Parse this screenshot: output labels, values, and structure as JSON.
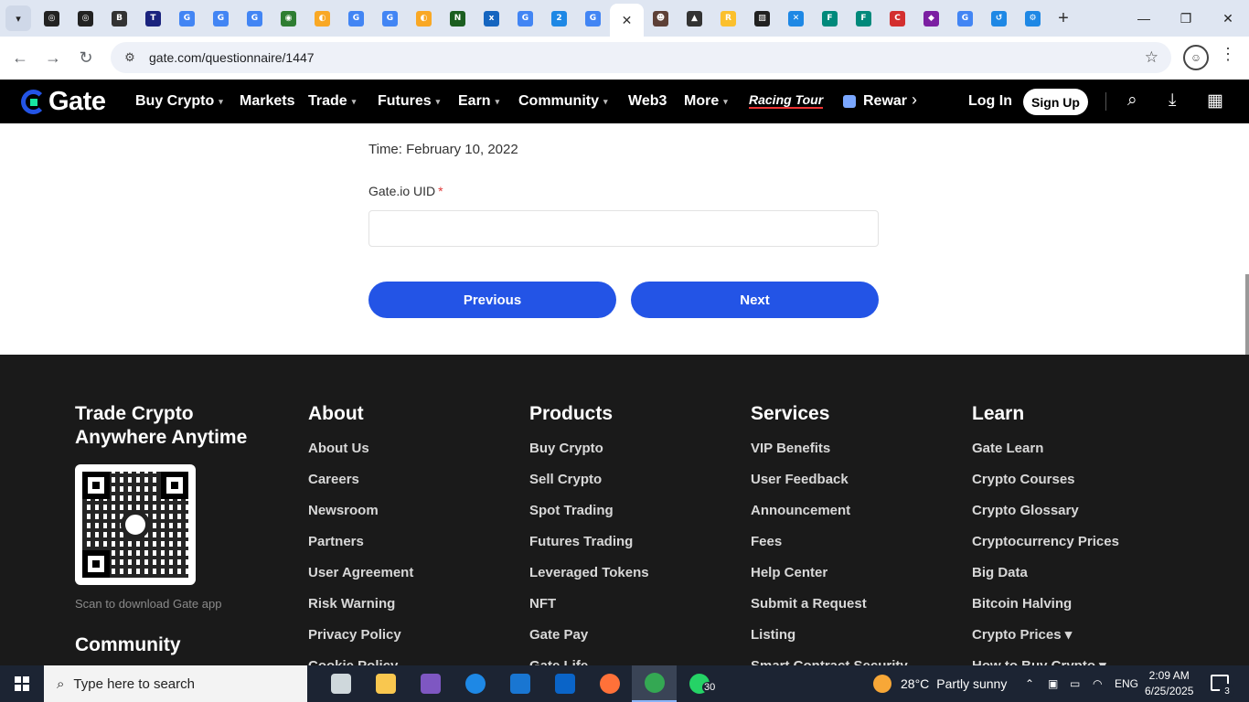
{
  "browser": {
    "tab_favicons": [
      {
        "name": "openai-tab",
        "color": "#222222",
        "glyph": "◎"
      },
      {
        "name": "openai-tab-2",
        "color": "#222222",
        "glyph": "◎"
      },
      {
        "name": "bitcoin-tab",
        "color": "#333333",
        "glyph": "B"
      },
      {
        "name": "ttp-tab",
        "color": "#1a237e",
        "glyph": "T"
      },
      {
        "name": "google-tab",
        "color": "#4285f4",
        "glyph": "G"
      },
      {
        "name": "google-tab",
        "color": "#4285f4",
        "glyph": "G"
      },
      {
        "name": "google-tab",
        "color": "#4285f4",
        "glyph": "G"
      },
      {
        "name": "globe-tab",
        "color": "#2e7d32",
        "glyph": "◉"
      },
      {
        "name": "app-tab",
        "color": "#f9a825",
        "glyph": "◐"
      },
      {
        "name": "google-tab",
        "color": "#4285f4",
        "glyph": "G"
      },
      {
        "name": "google-tab",
        "color": "#4285f4",
        "glyph": "G"
      },
      {
        "name": "app-tab",
        "color": "#f9a825",
        "glyph": "◐"
      },
      {
        "name": "nnn-tab",
        "color": "#1b5e20",
        "glyph": "N"
      },
      {
        "name": "xf-tab",
        "color": "#1565c0",
        "glyph": "x"
      },
      {
        "name": "google-tab",
        "color": "#4285f4",
        "glyph": "G"
      },
      {
        "name": "two-tab",
        "color": "#1e88e5",
        "glyph": "2"
      },
      {
        "name": "google-tab",
        "color": "#4285f4",
        "glyph": "G"
      }
    ],
    "active_tab_close": "✕",
    "tab_favicons_after": [
      {
        "name": "person-tab",
        "color": "#5d4037",
        "glyph": "☻"
      },
      {
        "name": "arrow-tab",
        "color": "#333333",
        "glyph": "▲"
      },
      {
        "name": "r-tab",
        "color": "#fbc02d",
        "glyph": "R"
      },
      {
        "name": "ruler-tab",
        "color": "#212121",
        "glyph": "▨"
      },
      {
        "name": "x-tab",
        "color": "#1e88e5",
        "glyph": "✕"
      },
      {
        "name": "f-tab",
        "color": "#00897b",
        "glyph": "F"
      },
      {
        "name": "f-tab-2",
        "color": "#00897b",
        "glyph": "F"
      },
      {
        "name": "c-tab",
        "color": "#d32f2f",
        "glyph": "C"
      },
      {
        "name": "gem-tab",
        "color": "#7b1fa2",
        "glyph": "◆"
      },
      {
        "name": "google-tab",
        "color": "#4285f4",
        "glyph": "G"
      },
      {
        "name": "history-tab",
        "color": "#1e88e5",
        "glyph": "↺"
      },
      {
        "name": "settings-tab",
        "color": "#1e88e5",
        "glyph": "⚙"
      }
    ],
    "url": "gate.com/questionnaire/1447"
  },
  "header": {
    "logo": "Gate",
    "nav": [
      {
        "label": "Buy Crypto",
        "caret": "▾"
      },
      {
        "label": "Markets",
        "caret": ""
      },
      {
        "label": "Trade",
        "caret": "▾"
      },
      {
        "label": "Futures",
        "caret": "▾"
      },
      {
        "label": "Earn",
        "caret": "▾"
      },
      {
        "label": "Community",
        "caret": "▾"
      },
      {
        "label": "Web3",
        "caret": ""
      },
      {
        "label": "More",
        "caret": "▾"
      }
    ],
    "racing": "Racing Tour",
    "rewards": "Rewar",
    "login": "Log In",
    "signup": "Sign Up"
  },
  "form": {
    "time": "Time: February 10, 2022",
    "uid_label": "Gate.io UID",
    "required_mark": "*",
    "uid_value": "",
    "previous": "Previous",
    "next": "Next"
  },
  "footer": {
    "app_title": "Trade Crypto Anywhere Anytime",
    "scan_text": "Scan to download Gate app",
    "community": "Community",
    "columns": [
      {
        "title": "About",
        "links": [
          "About Us",
          "Careers",
          "Newsroom",
          "Partners",
          "User Agreement",
          "Risk Warning",
          "Privacy Policy",
          "Cookie Policy"
        ]
      },
      {
        "title": "Products",
        "links": [
          "Buy Crypto",
          "Sell Crypto",
          "Spot Trading",
          "Futures Trading",
          "Leveraged Tokens",
          "NFT",
          "Gate Pay",
          "Gate Life"
        ]
      },
      {
        "title": "Services",
        "links": [
          "VIP Benefits",
          "User Feedback",
          "Announcement",
          "Fees",
          "Help Center",
          "Submit a Request",
          "Listing",
          "Smart Contract Security"
        ]
      },
      {
        "title": "Learn",
        "links": [
          "Gate Learn",
          "Crypto Courses",
          "Crypto Glossary",
          "Cryptocurrency Prices",
          "Big Data",
          "Bitcoin Halving",
          "Crypto Prices ▾",
          "How to Buy Crypto ▾"
        ]
      }
    ]
  },
  "taskbar": {
    "search_placeholder": "Type here to search",
    "weather_temp": "28°C",
    "weather_text": "Partly sunny",
    "lang": "ENG",
    "time": "2:09 AM",
    "date": "6/25/2025",
    "whatsapp_badge": "30",
    "notif_badge": "3",
    "apps": [
      {
        "name": "task-view",
        "color": "#cfd8dc"
      },
      {
        "name": "file-explorer",
        "color": "#f9c74f"
      },
      {
        "name": "copilot",
        "color": "#7e57c2"
      },
      {
        "name": "edge",
        "color": "#1e88e5"
      },
      {
        "name": "store",
        "color": "#1976d2"
      },
      {
        "name": "outlook",
        "color": "#0a64c8"
      },
      {
        "name": "firefox",
        "color": "#ff7139"
      },
      {
        "name": "chrome",
        "color": "#34a853"
      },
      {
        "name": "whatsapp",
        "color": "#25d366"
      }
    ]
  }
}
